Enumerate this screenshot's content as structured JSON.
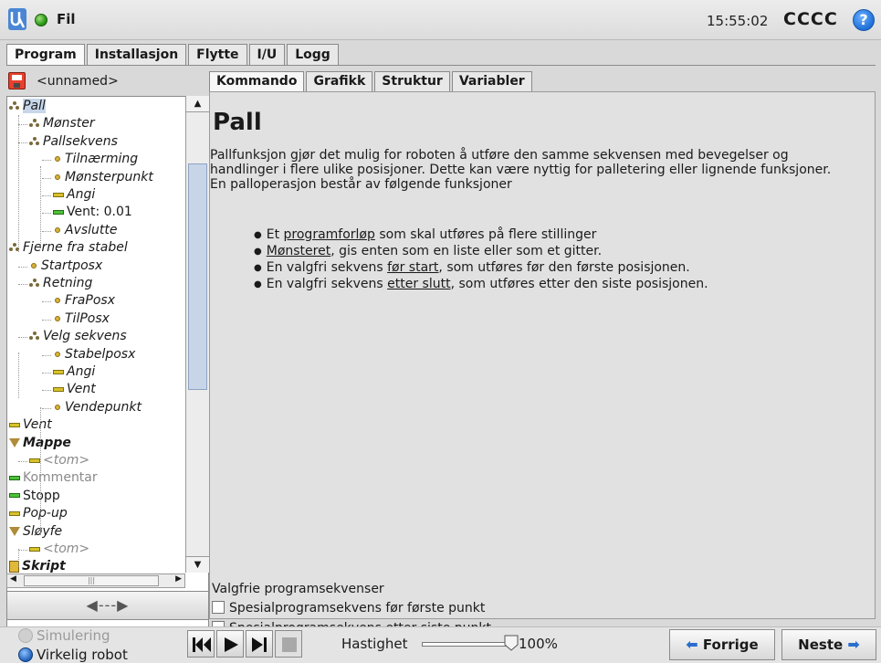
{
  "header": {
    "file_label": "Fil",
    "clock": "15:55:02",
    "robot_name": "CCCC",
    "help_glyph": "?"
  },
  "top_tabs": [
    "Program",
    "Installasjon",
    "Flytte",
    "I/U",
    "Logg"
  ],
  "program": {
    "name": "<unnamed>"
  },
  "tree": [
    {
      "label": "Pall",
      "icon": "pallet-icon"
    },
    {
      "label": "Mønster",
      "icon": "pallet-icon"
    },
    {
      "label": "Pallsekvens",
      "icon": "pallet-icon"
    },
    {
      "label": "Tilnærming",
      "icon": "waypoint-icon"
    },
    {
      "label": "Mønsterpunkt",
      "icon": "waypoint-icon"
    },
    {
      "label": "Angi",
      "icon": "set-icon"
    },
    {
      "label": "Vent: 0.01",
      "icon": "wait-icon"
    },
    {
      "label": "Avslutte",
      "icon": "waypoint-icon"
    },
    {
      "label": "Fjerne fra stabel",
      "icon": "pallet-icon"
    },
    {
      "label": "Startposx",
      "icon": "waypoint-icon"
    },
    {
      "label": "Retning",
      "icon": "pallet-icon"
    },
    {
      "label": "FraPosx",
      "icon": "waypoint-icon"
    },
    {
      "label": "TilPosx",
      "icon": "waypoint-icon"
    },
    {
      "label": "Velg sekvens",
      "icon": "pallet-icon"
    },
    {
      "label": "Stabelposx",
      "icon": "waypoint-icon"
    },
    {
      "label": "Angi",
      "icon": "set-icon"
    },
    {
      "label": "Vent",
      "icon": "set-icon"
    },
    {
      "label": "Vendepunkt",
      "icon": "waypoint-icon"
    },
    {
      "label": "Vent",
      "icon": "set-icon"
    },
    {
      "label": "Mappe",
      "icon": "folder-icon"
    },
    {
      "label": "<tom>",
      "icon": "set-icon"
    },
    {
      "label": "Kommentar",
      "icon": "comment-icon"
    },
    {
      "label": "Stopp",
      "icon": "stop-icon"
    },
    {
      "label": "Pop-up",
      "icon": "popup-icon"
    },
    {
      "label": "Sløyfe",
      "icon": "loop-icon"
    },
    {
      "label": "<tom>",
      "icon": "set-icon"
    },
    {
      "label": "Skript",
      "icon": "script-icon"
    }
  ],
  "sub_tabs": [
    "Kommando",
    "Grafikk",
    "Struktur",
    "Variabler"
  ],
  "command": {
    "title": "Pall",
    "description": "Pallfunksjon gjør det mulig for roboten å utføre den samme sekvensen med bevegelser og handlinger i flere ulike posisjoner. Dette kan være nyttig for palletering eller lignende funksjoner. En palloperasjon består av følgende funksjoner",
    "bullets": [
      {
        "pre": "Et ",
        "link": "programforløp",
        "post": " som skal utføres på flere stillinger"
      },
      {
        "pre": "",
        "link": "Mønsteret",
        "post": ", gis enten som en liste eller som et gitter."
      },
      {
        "pre": "En valgfri sekvens ",
        "link": "før start",
        "post": ", som utføres før den første posisjonen."
      },
      {
        "pre": "En valgfri sekvens ",
        "link": "etter slutt",
        "post": ", som utføres etter den siste posisjonen."
      }
    ],
    "optional_title": "Valgfrie programsekvenser",
    "option_before": "Spesialprogramsekvens før første punkt",
    "option_after": "Spesialprogramsekvens etter siste punkt"
  },
  "footer": {
    "simulation": "Simulering",
    "real_robot": "Virkelig robot",
    "speed_label": "Hastighet",
    "speed_percent": "100%",
    "speed_value": 1.0,
    "prev": "Forrige",
    "next": "Neste"
  },
  "colors": {
    "accent_blue": "#2a6fd0",
    "status_green": "#2b9a18",
    "save_red": "#e8412d"
  }
}
